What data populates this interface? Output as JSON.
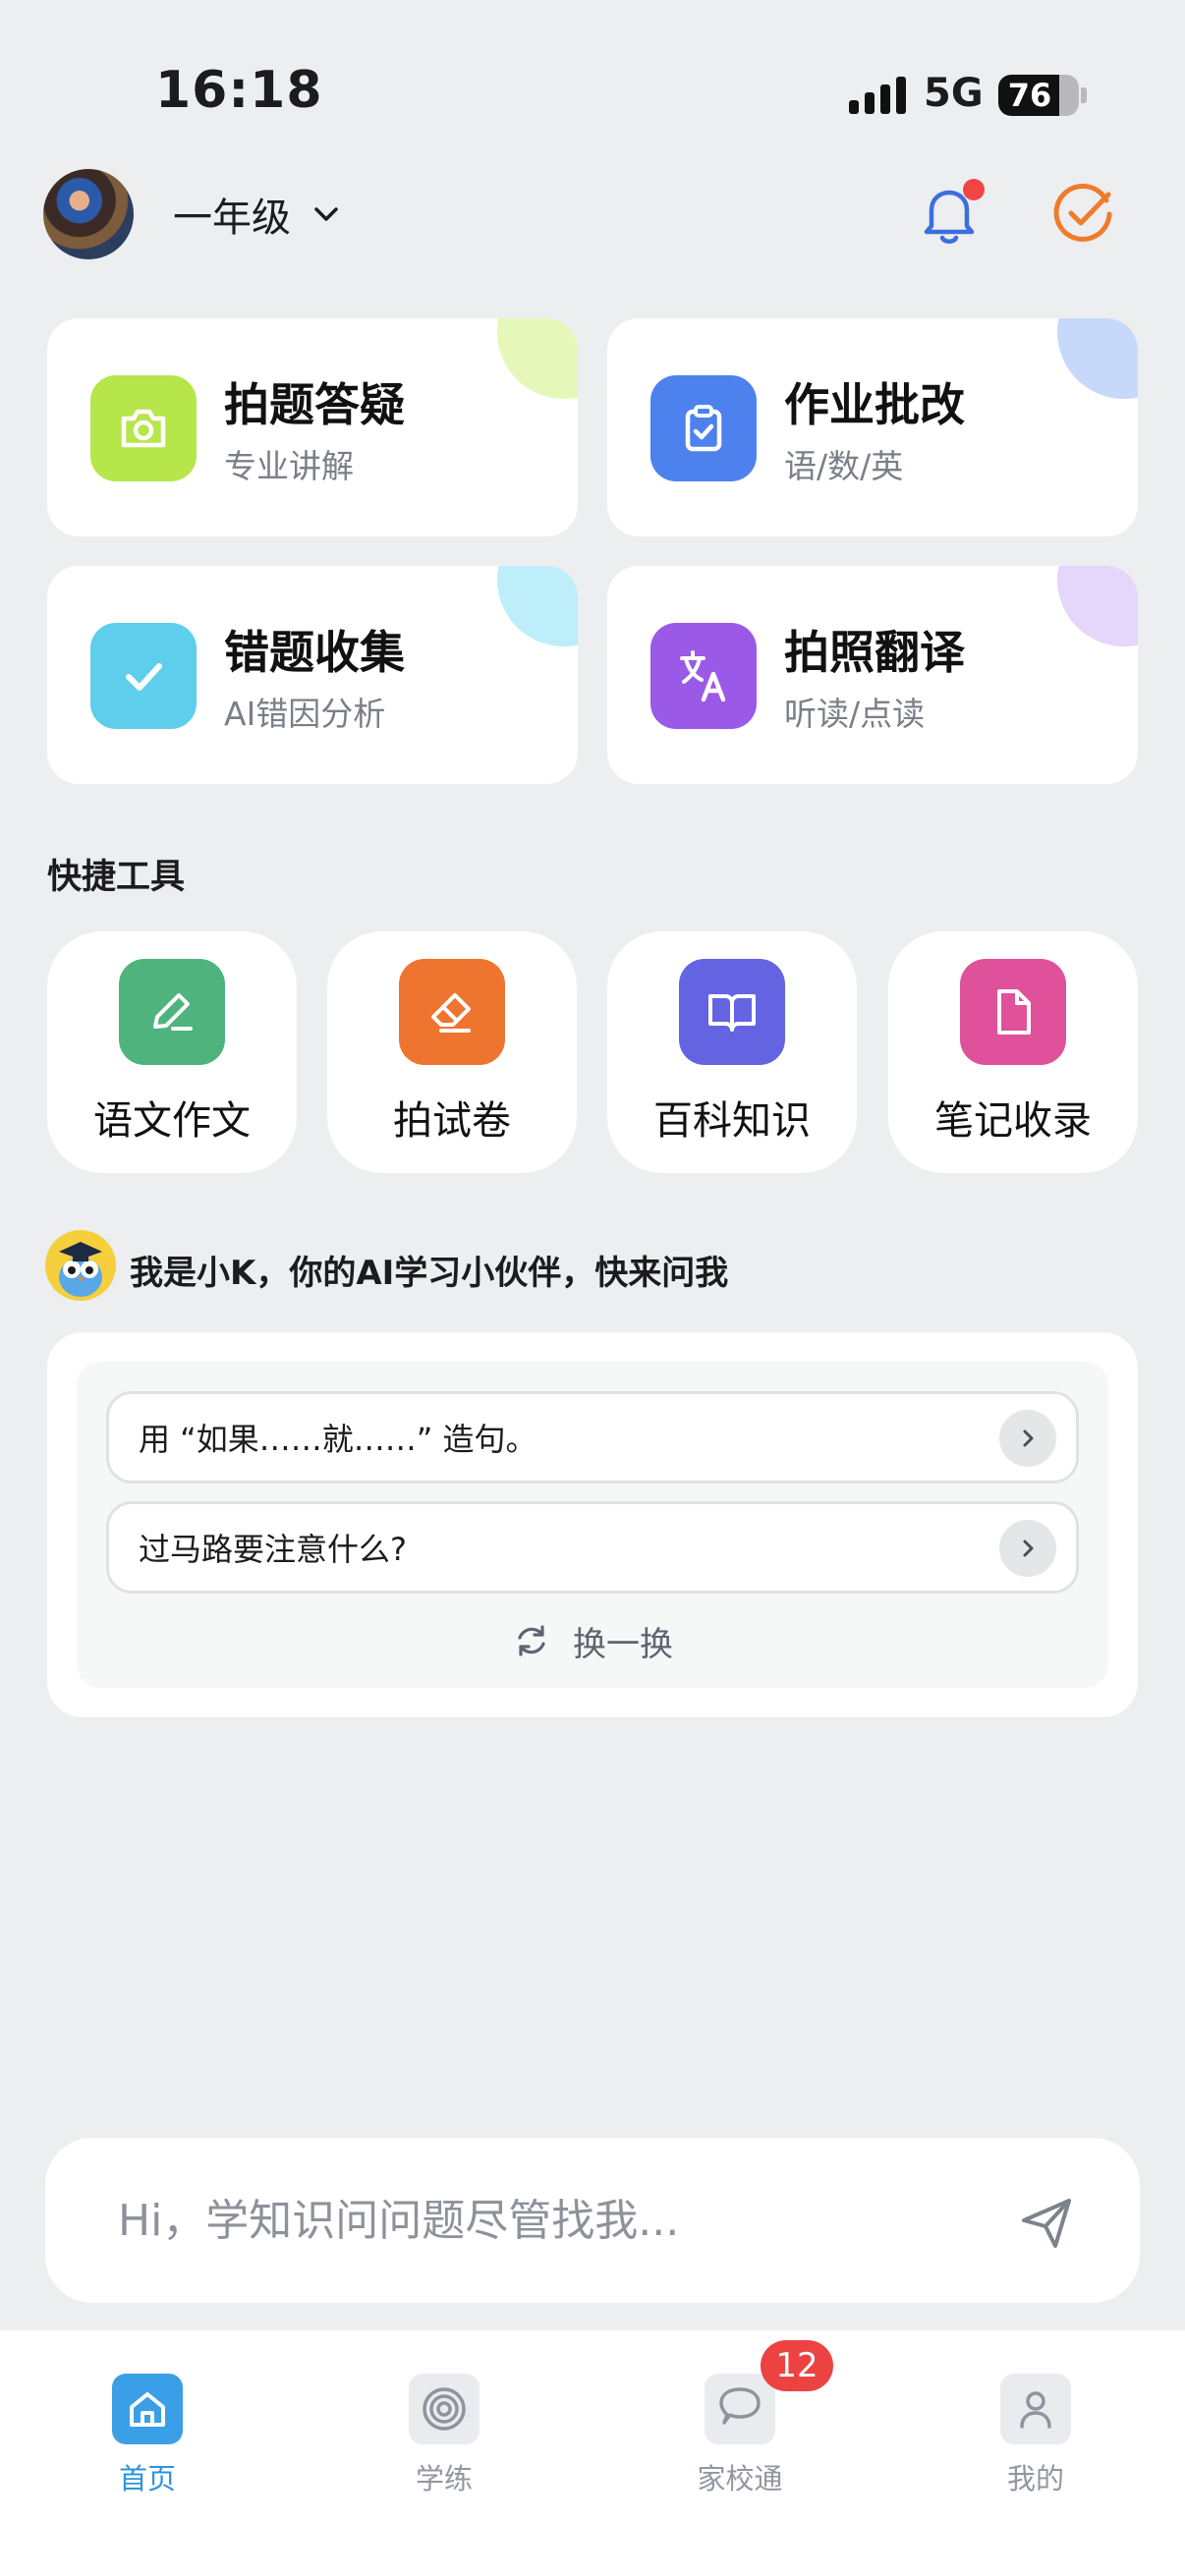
{
  "status_bar": {
    "time": "16:18",
    "network": "5G",
    "battery": "76",
    "battery_level": 0.76
  },
  "header": {
    "grade": "一年级"
  },
  "feature_cards": [
    {
      "title": "拍题答疑",
      "subtitle": "专业讲解",
      "icon": "camera-icon",
      "color": "#b6e64a",
      "corner_color": "#e6f8b9"
    },
    {
      "title": "作业批改",
      "subtitle": "语/数/英",
      "icon": "clipboard-check-icon",
      "color": "#4d82ee",
      "corner_color": "#c7d9fb"
    },
    {
      "title": "错题收集",
      "subtitle": "AI错因分析",
      "icon": "checkmark-icon",
      "color": "#5fcdec",
      "corner_color": "#bdeefa"
    },
    {
      "title": "拍照翻译",
      "subtitle": "听读/点读",
      "icon": "translate-icon",
      "color": "#9b59e8",
      "corner_color": "#e5d6fb"
    }
  ],
  "quick_tools": {
    "title": "快捷工具",
    "items": [
      {
        "label": "语文作文",
        "icon": "pen-icon",
        "color": "#4fb37d"
      },
      {
        "label": "拍试卷",
        "icon": "eraser-icon",
        "color": "#ee7530"
      },
      {
        "label": "百科知识",
        "icon": "book-icon",
        "color": "#6464e2"
      },
      {
        "label": "笔记收录",
        "icon": "document-icon",
        "color": "#e0519b"
      }
    ]
  },
  "ai_assistant": {
    "intro": "我是小K，你的AI学习小伙伴，快来问我",
    "suggestions": [
      "用 “如果……就……” 造句。",
      "过马路要注意什么?"
    ],
    "refresh_label": "换一换"
  },
  "chat": {
    "placeholder": "Hi，学知识问问题尽管找我..."
  },
  "tab_bar": {
    "tabs": [
      {
        "label": "首页",
        "icon": "home-icon",
        "active": true
      },
      {
        "label": "学练",
        "icon": "target-icon"
      },
      {
        "label": "家校通",
        "icon": "chat-bubble-icon",
        "badge": "12"
      },
      {
        "label": "我的",
        "icon": "user-icon"
      }
    ]
  }
}
